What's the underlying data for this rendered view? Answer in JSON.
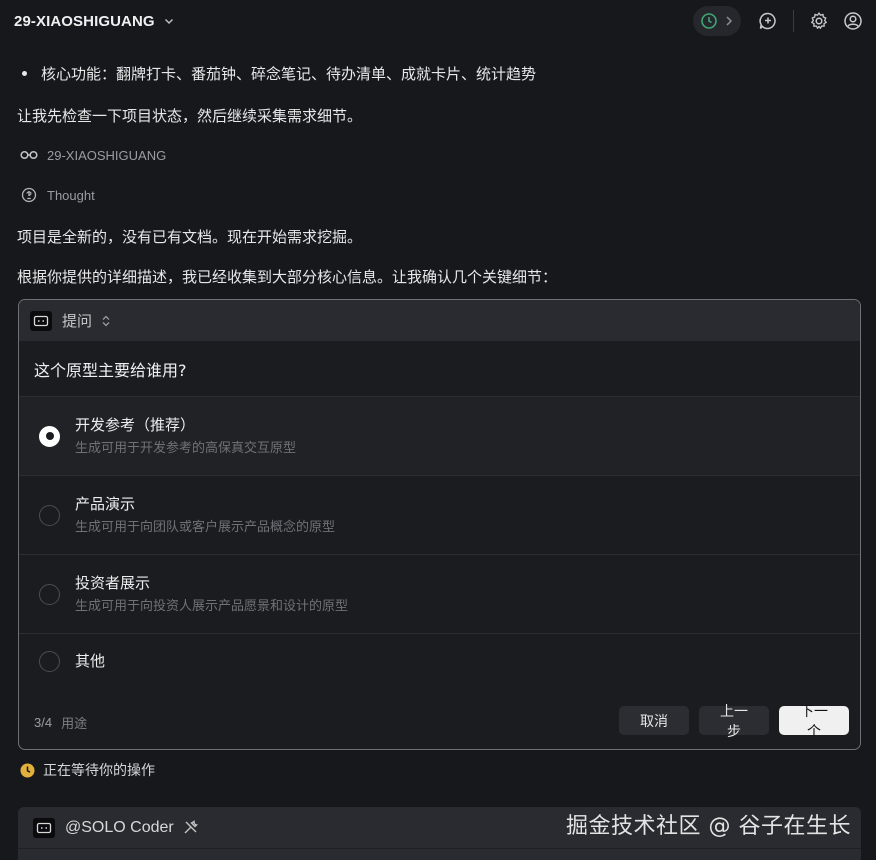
{
  "header": {
    "project_title": "29-XIAOSHIGUANG",
    "icons": [
      "chevron-down-icon",
      "clock-status-icon",
      "chevron-right-icon",
      "new-chat-icon",
      "settings-icon",
      "account-icon"
    ]
  },
  "conversation": {
    "bullet": "核心功能：翻牌打卡、番茄钟、碎念笔记、待办清单、成就卡片、统计趋势",
    "check_intro": "让我先检查一下项目状态，然后继续采集需求细节。",
    "folder_ref": "29-XIAOSHIGUANG",
    "thought_label": "Thought",
    "project_new": "项目是全新的，没有已有文档。现在开始需求挖掘。",
    "confirm_intro": "根据你提供的详细描述，我已经收集到大部分核心信息。让我确认几个关键细节："
  },
  "question_card": {
    "header_title": "提问",
    "question": "这个原型主要给谁用?",
    "options": [
      {
        "title": "开发参考（推荐）",
        "desc": "生成可用于开发参考的高保真交互原型",
        "selected": true
      },
      {
        "title": "产品演示",
        "desc": "生成可用于向团队或客户展示产品概念的原型",
        "selected": false
      },
      {
        "title": "投资者展示",
        "desc": "生成可用于向投资人展示产品愿景和设计的原型",
        "selected": false
      },
      {
        "title": "其他",
        "desc": "",
        "selected": false
      }
    ],
    "step": "3/4",
    "step_name": "用途",
    "cancel_label": "取消",
    "prev_label": "上一步",
    "next_label": "下一个"
  },
  "status": {
    "waiting": "正在等待你的操作"
  },
  "coder_card": {
    "name": "@SOLO Coder"
  },
  "watermark": "掘金技术社区 @ 谷子在生长",
  "colors": {
    "background": "#17181c",
    "card_header": "#2a2b30",
    "waiting_icon": "#e2b13c",
    "status_ok": "#3fa672"
  }
}
